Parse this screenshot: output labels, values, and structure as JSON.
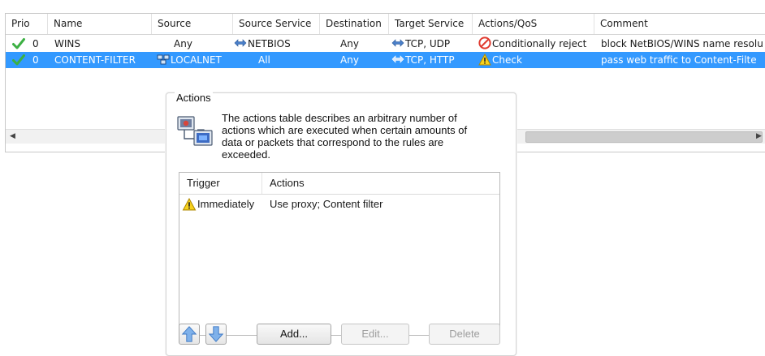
{
  "grid": {
    "columns": [
      "Prio",
      "Name",
      "Source",
      "Source Service",
      "Destination",
      "Target Service",
      "Actions/QoS",
      "Comment"
    ],
    "rows": [
      {
        "prio": "0",
        "name": "WINS",
        "source": "Any",
        "source_service": "NETBIOS",
        "destination": "Any",
        "target_service": "TCP, UDP",
        "action": "Conditionally reject",
        "comment": "block NetBIOS/WINS name resolu",
        "selected": false
      },
      {
        "prio": "0",
        "name": "CONTENT-FILTER",
        "source": "LOCALNET",
        "source_service": "All",
        "destination": "Any",
        "target_service": "TCP, HTTP",
        "action": "Check",
        "comment": "pass web traffic to Content-Filte",
        "selected": true
      }
    ],
    "scroll_left": "◀",
    "scroll_right": "▶"
  },
  "actions_panel": {
    "legend": "Actions",
    "description": "The actions table describes an arbitrary number of actions which are executed when certain amounts of data or packets that correspond to the rules are exceeded.",
    "table": {
      "columns": [
        "Trigger",
        "Actions"
      ],
      "rows": [
        {
          "trigger": "Immediately",
          "actions": "Use proxy; Content filter"
        }
      ]
    },
    "buttons": {
      "add": "Add...",
      "edit": "Edit...",
      "delete": "Delete"
    }
  },
  "colors": {
    "selection": "#3399ff",
    "check_green": "#3cb043",
    "reject_red": "#e03a2f",
    "warning_yellow": "#f7d21e"
  }
}
